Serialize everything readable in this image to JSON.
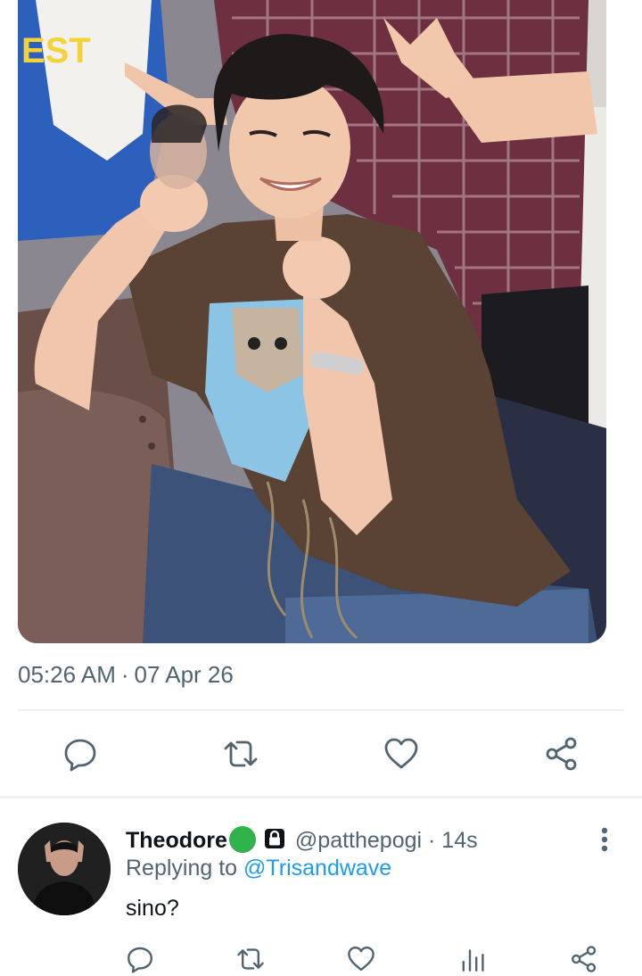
{
  "tweet": {
    "media_alt": "photo",
    "time": "05:26 AM",
    "separator": "·",
    "date": "07 Apr 26"
  },
  "actions": {
    "reply": "reply-icon",
    "retweet": "retweet-icon",
    "like": "heart-icon",
    "share": "share-icon"
  },
  "reply": {
    "display_name": "Theodore",
    "handle": "@patthepogi",
    "separator": "·",
    "time": "14s",
    "replying_prefix": "Replying to",
    "replying_to": "@Trisandwave",
    "text": "sino?"
  },
  "colors": {
    "secondary_text": "#536471",
    "link": "#1d9bf0",
    "divider": "#eef1f3",
    "status_emoji": "#2fb34a"
  }
}
